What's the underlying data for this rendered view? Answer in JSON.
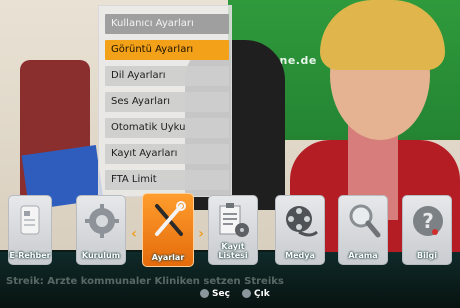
{
  "menu": {
    "header": "Kullanıcı Ayarları",
    "items": [
      {
        "label": "Görüntü Ayarları",
        "selected": true
      },
      {
        "label": "Dil Ayarları"
      },
      {
        "label": "Ses Ayarları"
      },
      {
        "label": "Otomatik Uyku"
      },
      {
        "label": "Kayıt Ayarları"
      },
      {
        "label": "FTA Limit"
      }
    ]
  },
  "iconbar": {
    "items": [
      {
        "label": "E-Rehber",
        "icon": "epg-icon"
      },
      {
        "label": "Kurulum",
        "icon": "gear-icon"
      },
      {
        "label": "Ayarlar",
        "icon": "tools-icon",
        "active": true
      },
      {
        "label": "Kayıt Listesi",
        "icon": "record-list-icon"
      },
      {
        "label": "Medya",
        "icon": "film-reel-icon"
      },
      {
        "label": "Arama",
        "icon": "magnifier-icon"
      },
      {
        "label": "Bilgi",
        "icon": "question-icon"
      }
    ],
    "arrow_left": "‹",
    "arrow_right": "›"
  },
  "background": {
    "banner_text": "rgruene.de",
    "ticker": "Streik: Arzte kommunaler Kliniken setzen Streiks"
  },
  "footer": {
    "select_label": "Seç",
    "exit_label": "Çık"
  },
  "colors": {
    "accent": "#f4a11a",
    "active_tile": "#ef7c14"
  }
}
